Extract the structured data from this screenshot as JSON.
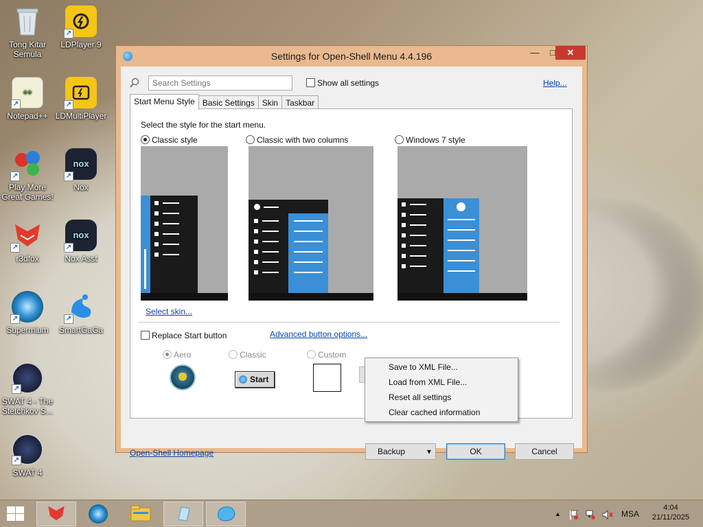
{
  "desktop": {
    "icons": [
      {
        "label": "Tong Kitar Semula",
        "icon": "recycle-bin-icon"
      },
      {
        "label": "LDPlayer 9",
        "icon": "ldplayer-icon"
      },
      {
        "label": "Notepad++",
        "icon": "notepad-plus-plus-icon"
      },
      {
        "label": "LDMultiPlayer",
        "icon": "ldmultiplayer-icon"
      },
      {
        "label": "Play More Great Games!",
        "icon": "games-icon"
      },
      {
        "label": "Nox",
        "icon": "nox-icon"
      },
      {
        "label": "r3dfox",
        "icon": "r3dfox-icon"
      },
      {
        "label": "Nox Asst",
        "icon": "nox-assistant-icon"
      },
      {
        "label": "Supermium",
        "icon": "supermium-icon"
      },
      {
        "label": "SmartGaGa",
        "icon": "smartgaga-icon"
      },
      {
        "label": "SWAT 4 - The Stetchkov S...",
        "icon": "swat4-icon"
      },
      {
        "label": "SWAT 4",
        "icon": "swat4-icon"
      }
    ]
  },
  "window": {
    "title": "Settings for Open-Shell Menu 4.4.196",
    "minimize": "—",
    "maximize": "□",
    "close": "✕",
    "search_placeholder": "Search Settings",
    "show_all_label": "Show all settings",
    "help_label": "Help...",
    "tabs": [
      "Start Menu Style",
      "Basic Settings",
      "Skin",
      "Taskbar"
    ],
    "active_tab": "Start Menu Style",
    "panel": {
      "prompt": "Select the style for the start menu.",
      "styles": [
        "Classic style",
        "Classic with two columns",
        "Windows 7 style"
      ],
      "selected_style": "Classic style",
      "select_skin_link": "Select skin...",
      "replace_start_label": "Replace Start button",
      "advanced_link": "Advanced button options...",
      "button_styles": [
        "Aero",
        "Classic",
        "Custom"
      ],
      "selected_button_style": "Aero",
      "classic_button_text": "Start"
    },
    "homepage_link": "Open-Shell Homepage",
    "backup_label": "Backup",
    "backup_arrow": "▾",
    "ok_label": "OK",
    "cancel_label": "Cancel"
  },
  "context_menu": {
    "items": [
      "Save to XML File...",
      "Load from XML File...",
      "Reset all settings",
      "Clear cached information"
    ]
  },
  "taskbar": {
    "language": "MSA",
    "time": "4:04",
    "date": "21/11/2025",
    "tray_up_arrow": "▲"
  }
}
